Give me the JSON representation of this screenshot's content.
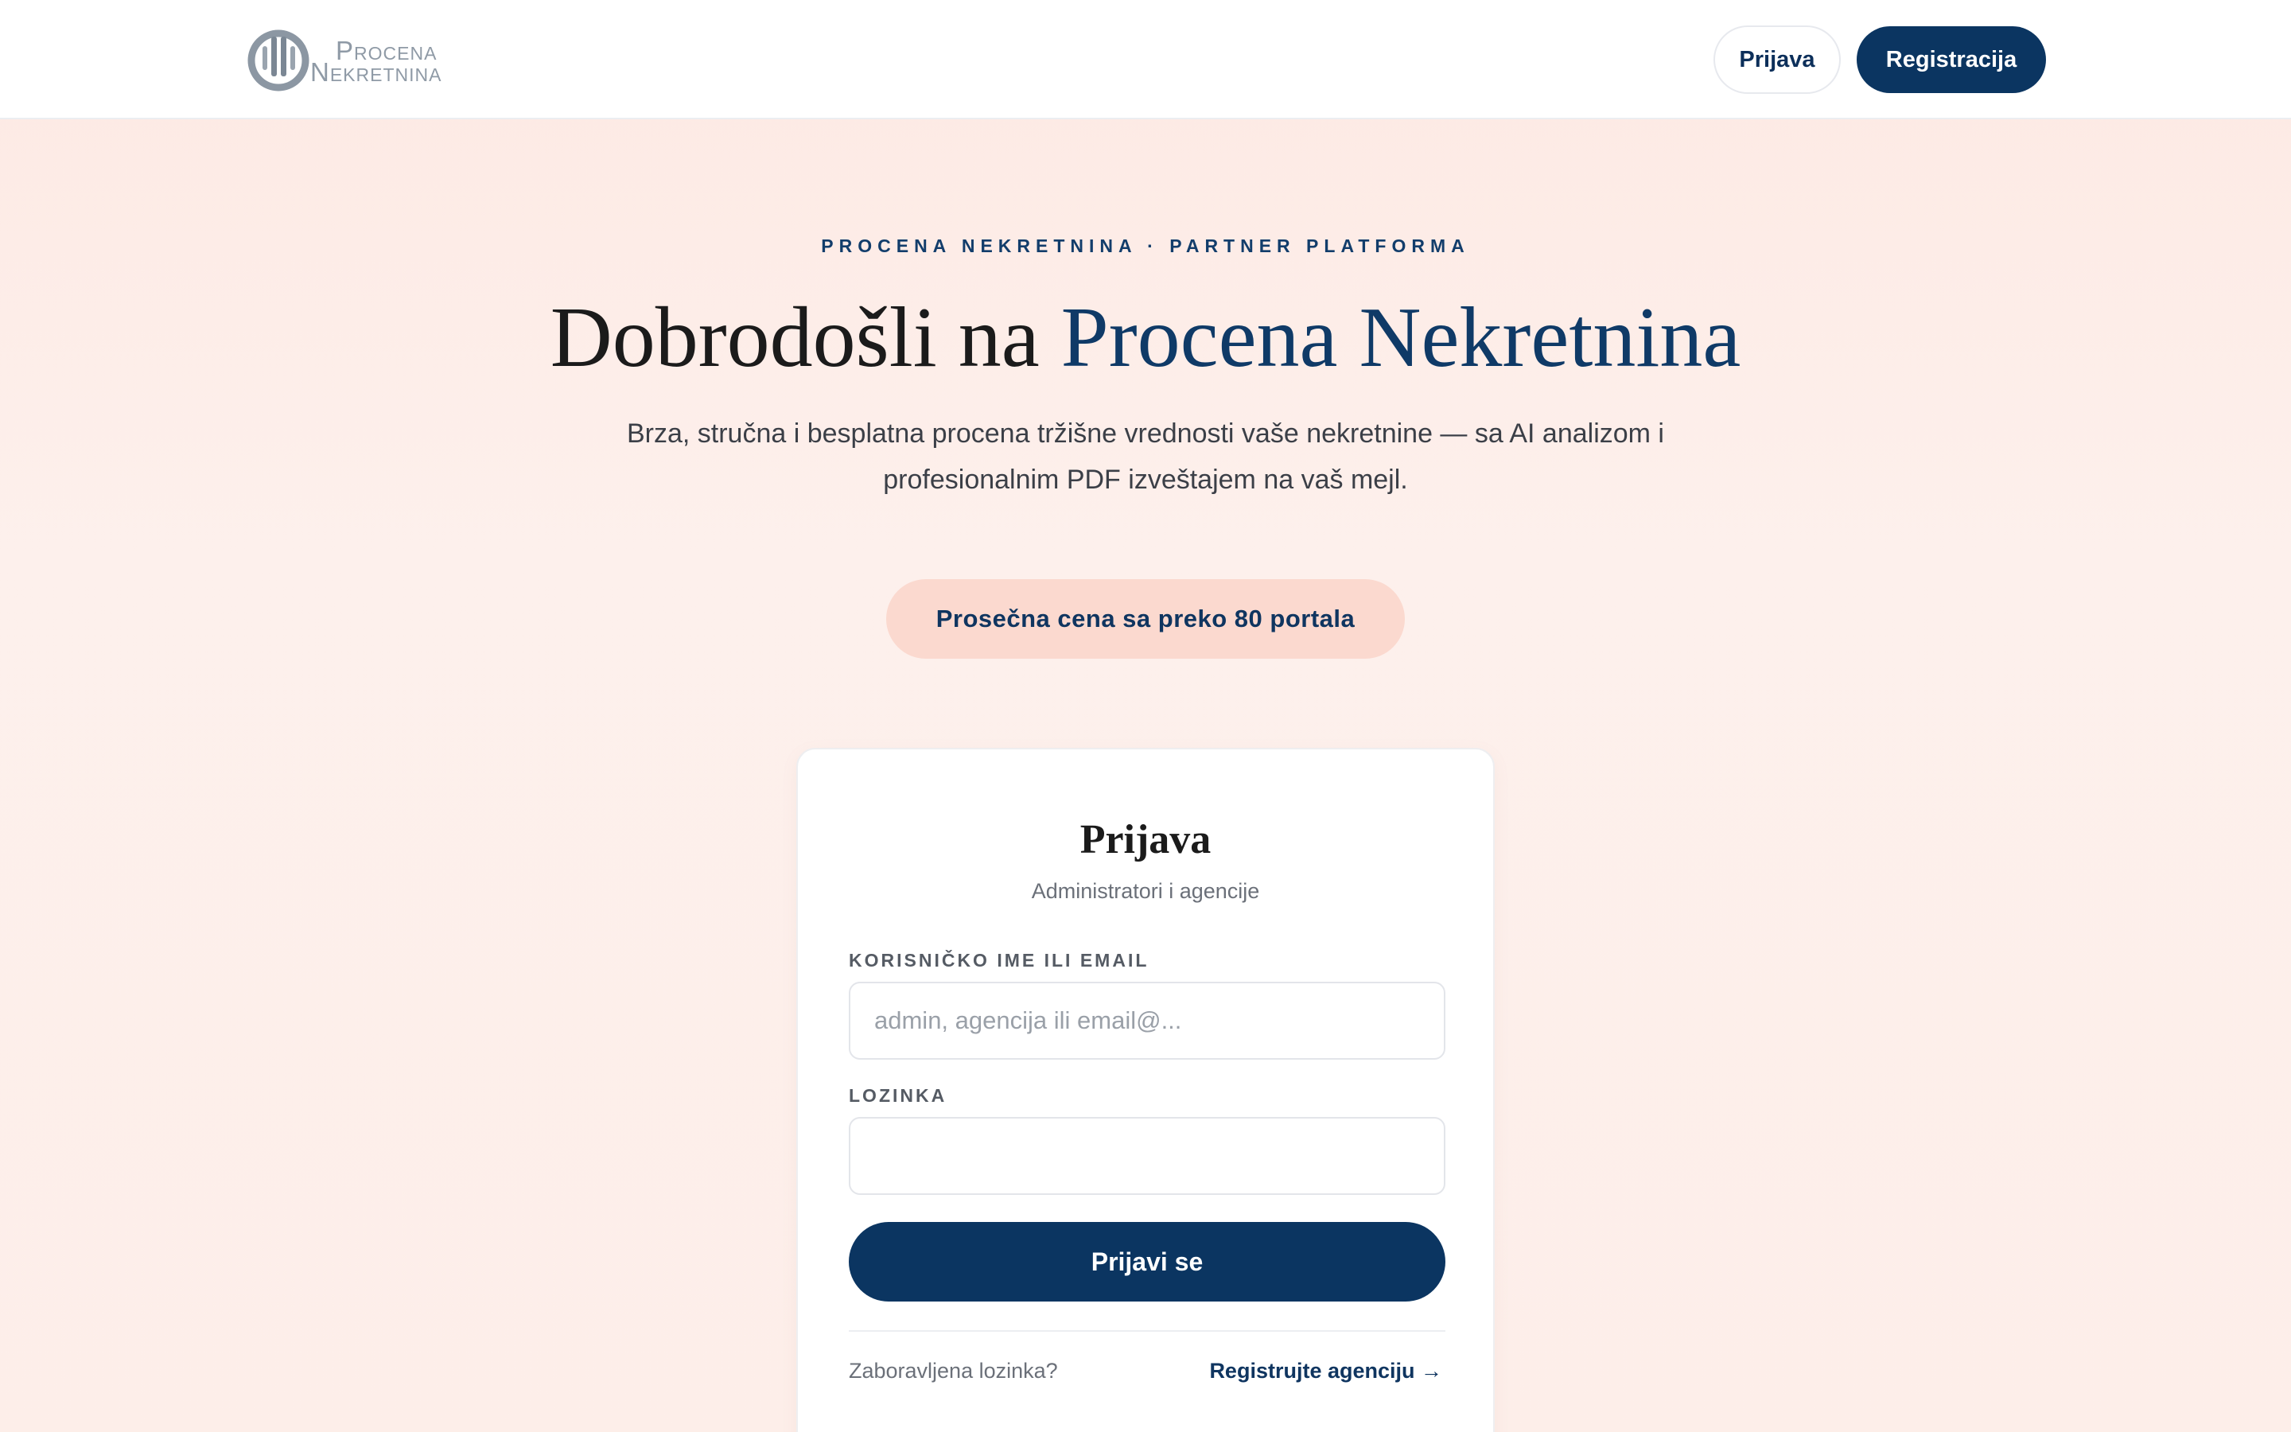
{
  "header": {
    "logo": {
      "line1": "Procena",
      "line2": "Nekretnina"
    },
    "login_label": "Prijava",
    "register_label": "Registracija"
  },
  "hero": {
    "eyebrow": "PROCENA NEKRETNINA · PARTNER PLATFORMA",
    "title_prefix": "Dobrodošli na ",
    "title_accent": "Procena Nekretnina",
    "subtitle": "Brza, stručna i besplatna procena tržišne vrednosti vaše nekretnine — sa AI analizom i profesionalnim PDF izveštajem na vaš mejl.",
    "pill": "Prosečna cena sa preko 80 portala"
  },
  "login_card": {
    "title": "Prijava",
    "subtitle": "Administratori i agencije",
    "username_label": "KORISNIČKO IME ILI EMAIL",
    "username_placeholder": "admin, agencija ili email@...",
    "username_value": "",
    "password_label": "LOZINKA",
    "password_value": "",
    "submit_label": "Prijavi se",
    "forgot_label": "Zaboravljena lozinka?",
    "register_agency_label": "Registrujte agenciju →"
  },
  "colors": {
    "brand_navy": "#0b3561",
    "accent_blue": "#0f3a67",
    "pill_bg": "#fbd9cf",
    "page_bg": "#fdeee9"
  }
}
